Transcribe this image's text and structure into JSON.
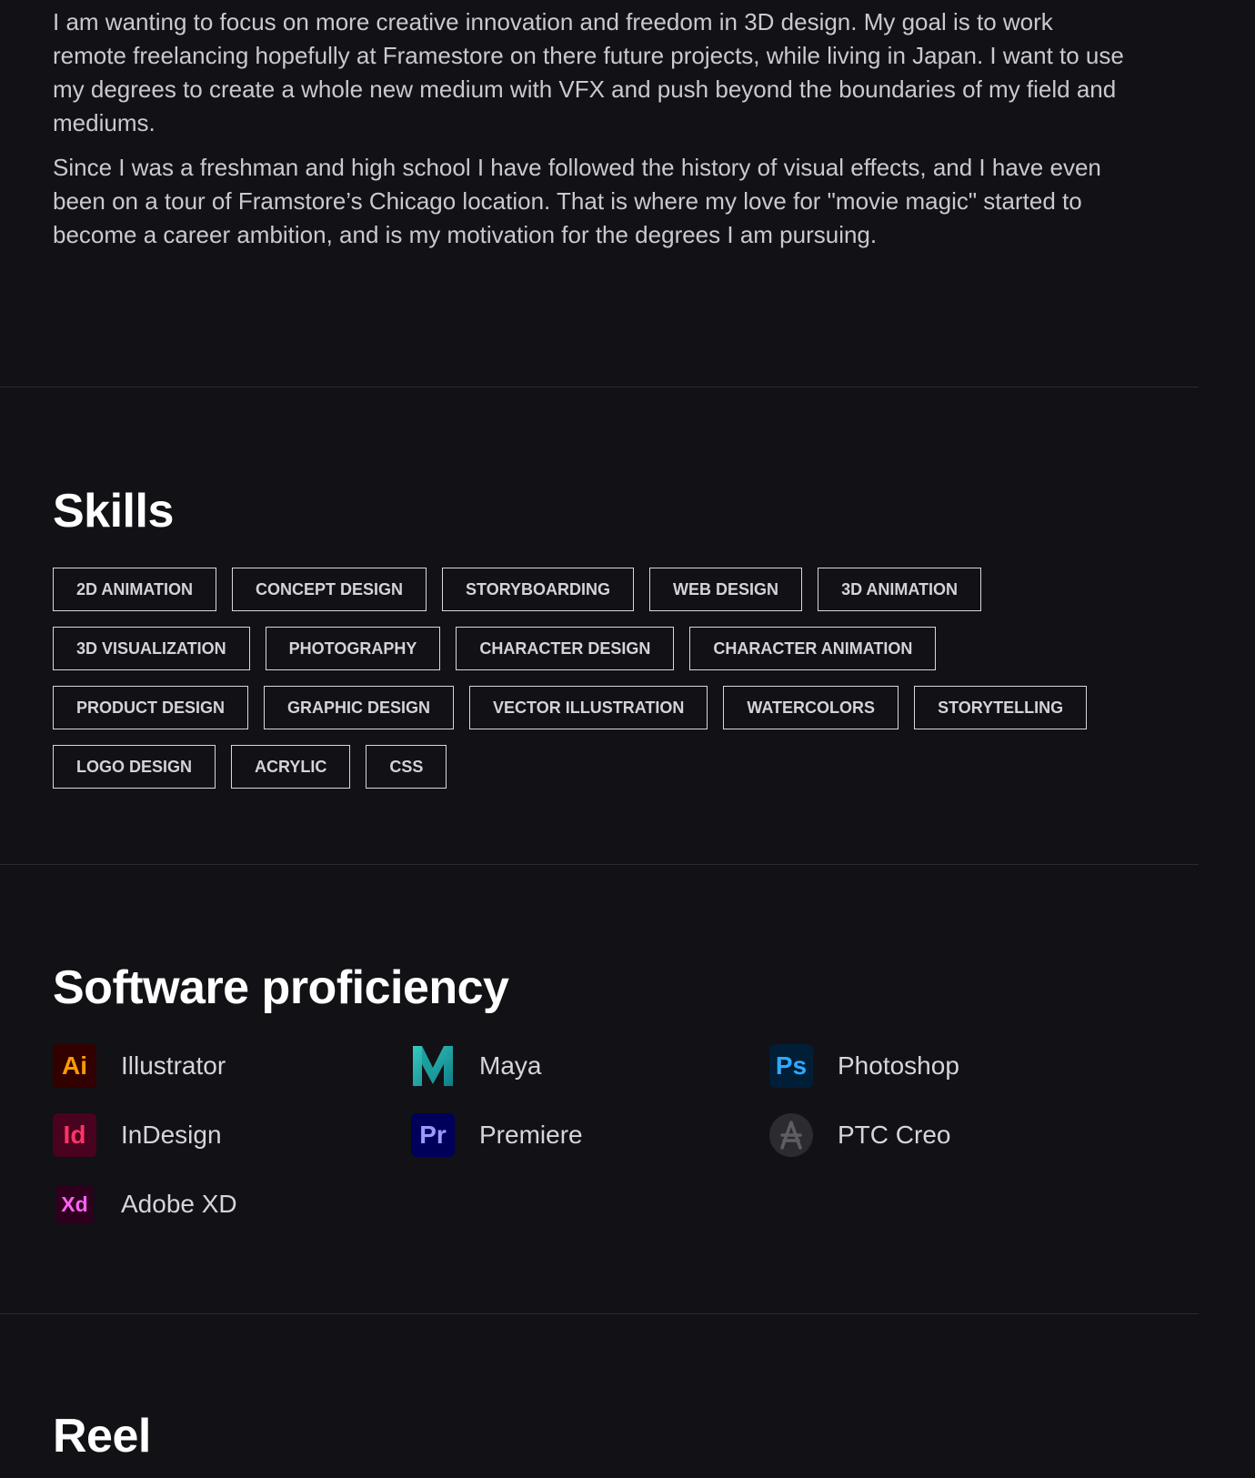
{
  "intro": {
    "paragraphs": [
      "I am wanting to focus on more creative innovation and freedom in 3D design. My goal is to work remote freelancing hopefully at Framestore on there future projects, while living in Japan. I want to use my degrees to create a whole new medium with VFX and push beyond the boundaries of my field and mediums.",
      "Since I was a freshman and high school I have followed the history of visual effects, and I have even been on a tour of Framstore’s Chicago location. That is where my love for \"movie magic\" started to become a career ambition, and is my motivation for the degrees I am pursuing."
    ]
  },
  "skills": {
    "title": "Skills",
    "rows": [
      [
        "2D ANIMATION",
        "CONCEPT DESIGN",
        "STORYBOARDING",
        "WEB DESIGN",
        "3D ANIMATION"
      ],
      [
        "3D VISUALIZATION",
        "PHOTOGRAPHY",
        "CHARACTER DESIGN",
        "CHARACTER ANIMATION"
      ],
      [
        "PRODUCT DESIGN",
        "GRAPHIC DESIGN",
        "VECTOR ILLUSTRATION",
        "WATERCOLORS",
        "STORYTELLING"
      ],
      [
        "LOGO DESIGN",
        "ACRYLIC",
        "CSS"
      ]
    ]
  },
  "software": {
    "title": "Software proficiency",
    "items": [
      {
        "name": "Illustrator",
        "icon": "illustrator-icon",
        "abbr": "Ai"
      },
      {
        "name": "Maya",
        "icon": "maya-icon",
        "abbr": ""
      },
      {
        "name": "Photoshop",
        "icon": "photoshop-icon",
        "abbr": "Ps"
      },
      {
        "name": "InDesign",
        "icon": "indesign-icon",
        "abbr": "Id"
      },
      {
        "name": "Premiere",
        "icon": "premiere-icon",
        "abbr": "Pr"
      },
      {
        "name": "PTC Creo",
        "icon": "ptc-creo-icon",
        "abbr": ""
      },
      {
        "name": "Adobe XD",
        "icon": "adobe-xd-icon",
        "abbr": "Xd"
      }
    ]
  },
  "reel": {
    "title": "Reel"
  },
  "colors": {
    "background": "#111116",
    "heading": "#ffffff",
    "body_text": "#c9c9cf",
    "tag_border": "#d8d8dc",
    "divider": "#2a2a31"
  }
}
